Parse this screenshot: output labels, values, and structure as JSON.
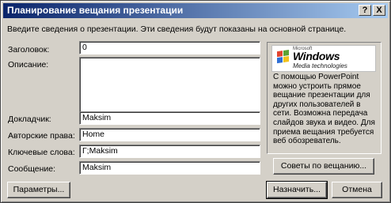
{
  "window": {
    "title": "Планирование вещания презентации",
    "help_label": "?",
    "close_label": "X"
  },
  "intro": "Введите сведения о презентации. Эти сведения будут показаны на основной странице.",
  "fields": {
    "title": {
      "label": "Заголовок:",
      "value": "0"
    },
    "description": {
      "label": "Описание:",
      "value": ""
    },
    "speaker": {
      "label": "Докладчик:",
      "value": "Maksim"
    },
    "copyright": {
      "label": "Авторские права:",
      "value": "Home"
    },
    "keywords": {
      "label": "Ключевые слова:",
      "value": "Г;Maksim"
    },
    "message": {
      "label": "Сообщение:",
      "value": "Maksim"
    }
  },
  "info": {
    "logo_small": "Microsoft",
    "logo_windows": "Windows",
    "logo_media": "Media technologies",
    "text": "С помощью PowerPoint можно устроить прямое вещание презентации для других пользователей в сети. Возможна передача слайдов звука и видео. Для приема вещания требуется веб обозреватель."
  },
  "buttons": {
    "tips": "Советы по вещанию...",
    "settings": "Параметры...",
    "schedule": "Назначить...",
    "cancel": "Отмена"
  },
  "colors": {
    "title_bar_start": "#0a246a",
    "title_bar_end": "#a6caf0",
    "dialog_bg": "#d4d0c8"
  }
}
